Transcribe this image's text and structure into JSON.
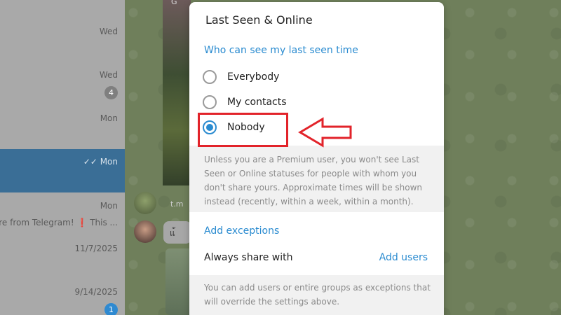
{
  "sidebar": {
    "chats": [
      {
        "date": "Wed"
      },
      {
        "date": "Wed",
        "badge": "4"
      },
      {
        "date": "Mon"
      },
      {
        "date": "Mon",
        "selected": true
      },
      {
        "date": "Mon",
        "snippet": "re from Telegram! ❗ This ..."
      },
      {
        "date": "11/7/2025"
      },
      {
        "date": "9/14/2025",
        "badge": "1"
      }
    ],
    "badge_gray": "#7f7f7f",
    "badge_blue": "#2f8ad1"
  },
  "chat": {
    "peek_letter": "G",
    "link_fragment": "t.m",
    "bubble_fragment": "แ้"
  },
  "modal": {
    "title": "Last Seen & Online",
    "section_who": "Who can see my last seen time",
    "options": [
      {
        "label": "Everybody",
        "checked": false
      },
      {
        "label": "My contacts",
        "checked": false
      },
      {
        "label": "Nobody",
        "checked": true
      }
    ],
    "info_1": "Unless you are a Premium user, you won't see Last Seen or Online statuses for people with whom you don't share yours. Approximate times will be shown instead (recently, within a week, within a month).",
    "section_exceptions": "Add exceptions",
    "always_share_label": "Always share with",
    "add_users_label": "Add users",
    "info_2": "You can add users or entire groups as exceptions that will override the settings above."
  },
  "colors": {
    "accent": "#2a8bd0",
    "annotation": "#e2232a"
  }
}
